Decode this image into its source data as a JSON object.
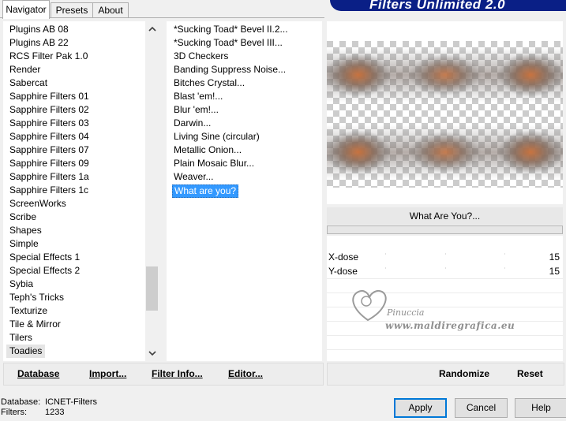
{
  "tabs": [
    "Navigator",
    "Presets",
    "About"
  ],
  "brand": "Filters Unlimited 2.0",
  "categories": [
    "Plugins AB 08",
    "Plugins AB 22",
    "RCS Filter Pak 1.0",
    "Render",
    "Sabercat",
    "Sapphire Filters 01",
    "Sapphire Filters 02",
    "Sapphire Filters 03",
    "Sapphire Filters 04",
    "Sapphire Filters 07",
    "Sapphire Filters 09",
    "Sapphire Filters 1a",
    "Sapphire Filters 1c",
    "ScreenWorks",
    "Scribe",
    "Shapes",
    "Simple",
    "Special Effects 1",
    "Special Effects 2",
    "Sybia",
    "Teph's Tricks",
    "Texturize",
    "Tile & Mirror",
    "Tilers",
    "Toadies"
  ],
  "selected_category": "Toadies",
  "filters": [
    "*Sucking Toad*  Bevel II.2...",
    "*Sucking Toad*  Bevel III...",
    "3D Checkers",
    "Banding Suppress Noise...",
    "Bitches Crystal...",
    "Blast 'em!...",
    "Blur 'em!...",
    "Darwin...",
    "Living Sine (circular)",
    "Metallic Onion...",
    "Plain Mosaic Blur...",
    "Weaver...",
    "What are you?"
  ],
  "selected_filter": "What are you?",
  "filter_title": "What Are You?...",
  "sliders": [
    {
      "label": "X-dose",
      "value": "15"
    },
    {
      "label": "Y-dose",
      "value": "15"
    }
  ],
  "watermark": {
    "name": "Pinuccia",
    "url": "www.maldiregrafica.eu"
  },
  "left_buttons": [
    "Database",
    "Import...",
    "Filter Info...",
    "Editor..."
  ],
  "right_buttons": [
    "Randomize",
    "Reset"
  ],
  "status": {
    "database_label": "Database:",
    "database_value": "ICNET-Filters",
    "filters_label": "Filters:",
    "filters_value": "1233"
  },
  "dialog_buttons": {
    "apply": "Apply",
    "cancel": "Cancel",
    "help": "Help"
  }
}
